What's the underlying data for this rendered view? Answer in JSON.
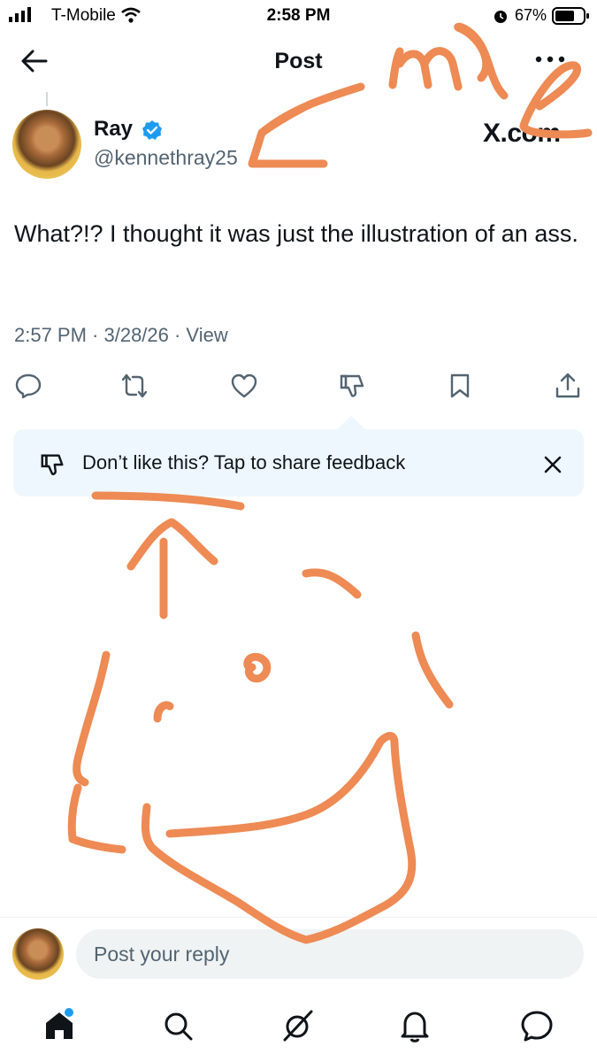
{
  "status_bar": {
    "carrier": "T-Mobile",
    "time": "2:58 PM",
    "battery_percent": "67%",
    "icons": [
      "signal-bars-icon",
      "wifi-icon",
      "alarm-icon",
      "battery-icon"
    ]
  },
  "header": {
    "title": "Post",
    "back_icon": "arrow-left-icon",
    "more_icon": "more-horizontal-icon"
  },
  "post": {
    "author_name": "Ray",
    "author_handle": "@kennethray25",
    "verified": true,
    "source_label": "X.com",
    "text": "What?!? I thought it was just the illustration of an ass.",
    "timestamp": "2:57 PM · 3/28/26 · View",
    "actions": [
      "reply-icon",
      "repost-icon",
      "like-icon",
      "dislike-icon",
      "bookmark-icon",
      "share-icon"
    ]
  },
  "feedback": {
    "text": "Don’t like this? Tap to share feedback",
    "icon": "thumbs-down-icon",
    "close_icon": "close-icon"
  },
  "reply": {
    "placeholder": "Post your reply"
  },
  "bottom_nav": {
    "items": [
      "home-icon",
      "search-icon",
      "grok-icon",
      "notifications-icon",
      "messages-icon"
    ],
    "home_badge": true
  },
  "colors": {
    "accent": "#1d9bf0",
    "text": "#0f1419",
    "secondary_text": "#536471",
    "feedback_bg": "#eef7fd",
    "annotation": "#ee8a54"
  }
}
